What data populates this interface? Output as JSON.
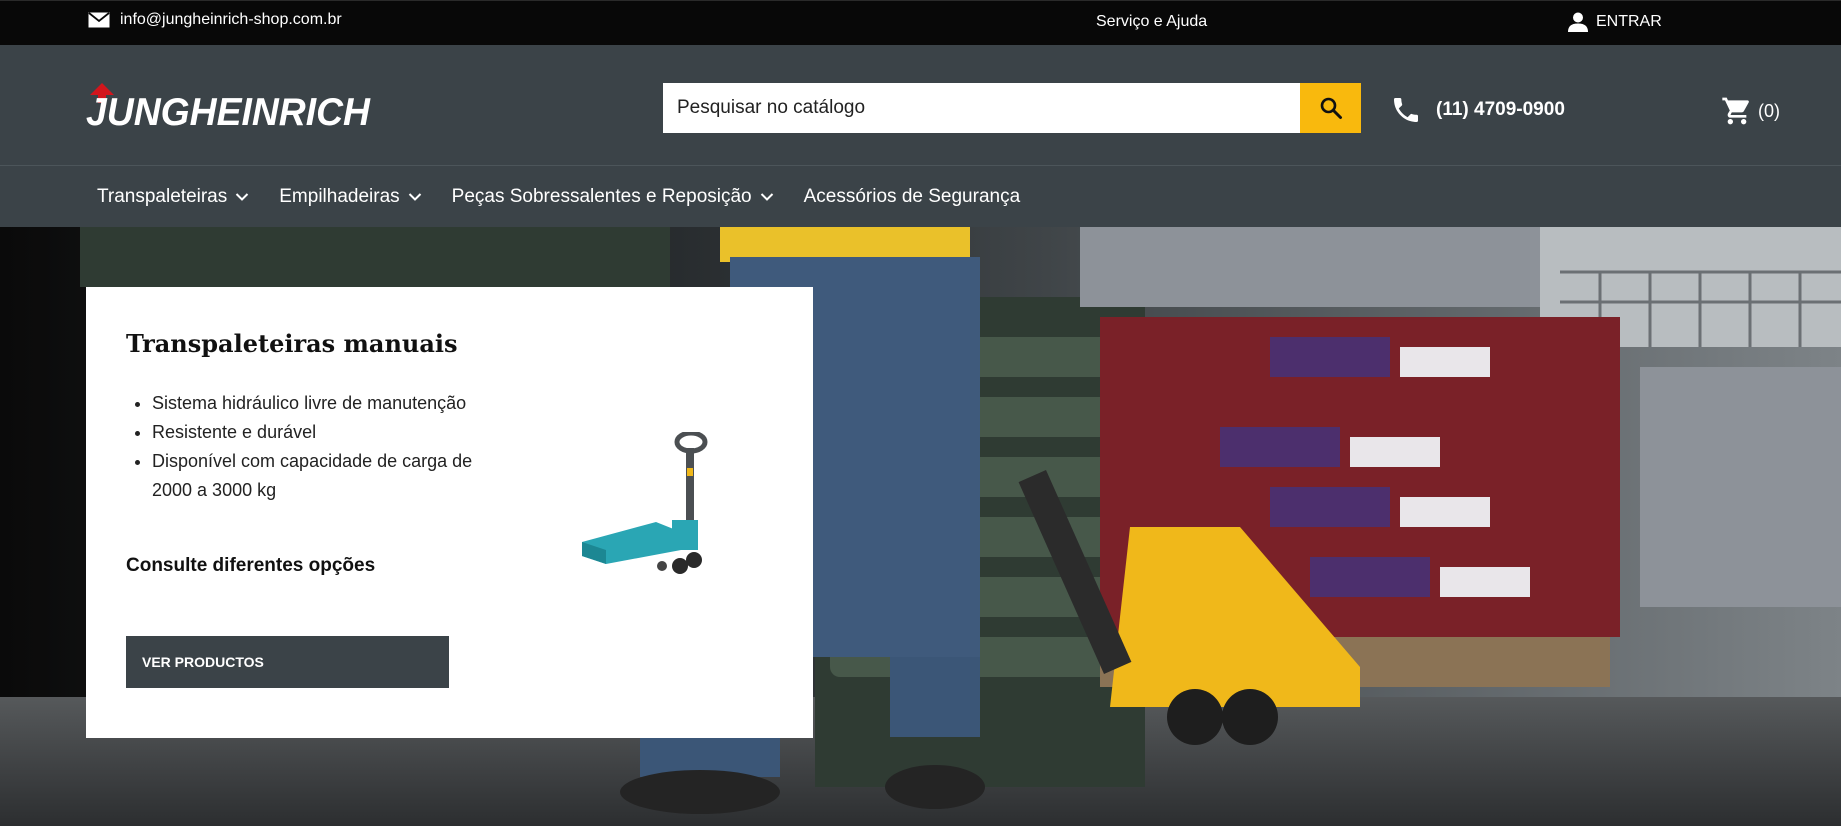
{
  "topbar": {
    "email": "info@jungheinrich-shop.com.br",
    "help": "Serviço e Ajuda",
    "login": "ENTRAR"
  },
  "header": {
    "logo_text": "JUNGHEINRICH",
    "search": {
      "placeholder": "Pesquisar no catálogo"
    },
    "phone": "(11) 4709-0900",
    "cart_count": "(0)"
  },
  "nav": {
    "items": [
      {
        "label": "Transpaleteiras",
        "has_dropdown": true
      },
      {
        "label": "Empilhadeiras",
        "has_dropdown": true
      },
      {
        "label": "Peças Sobressalentes e Reposição",
        "has_dropdown": true
      },
      {
        "label": "Acessórios de Segurança",
        "has_dropdown": false
      }
    ]
  },
  "hero_card": {
    "title": "Transpaleteiras manuais",
    "bullets": [
      "Sistema hidráulico livre de manutenção",
      "Resistente e durável",
      "Disponível com capacidade de carga de 2000 a 3000 kg"
    ],
    "consult": "Consulte diferentes opções",
    "cta": "VER PRODUCTOS"
  },
  "colors": {
    "topbar_bg": "#080808",
    "header_bg": "#3b4348",
    "accent_yellow": "#f9b90d",
    "logo_red": "#d2151c"
  },
  "icons": [
    "mail-icon",
    "user-icon",
    "search-icon",
    "phone-icon",
    "cart-icon",
    "chevron-down-icon"
  ]
}
